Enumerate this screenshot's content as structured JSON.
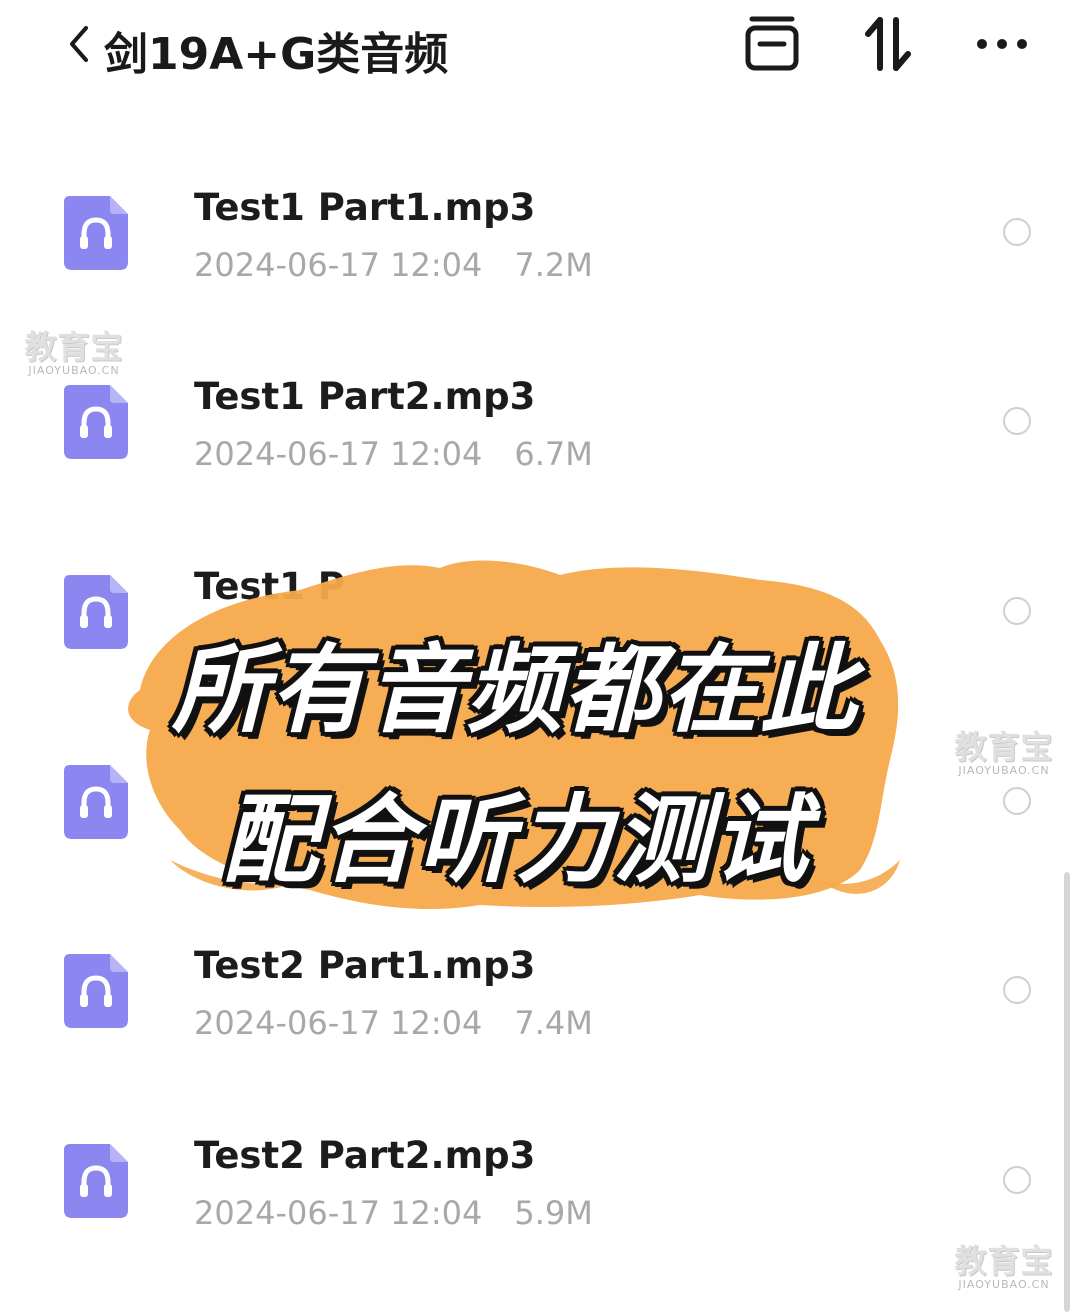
{
  "header": {
    "title": "剑19A+G类音频",
    "icons": [
      "chevron-left-icon",
      "select-icon",
      "sort-icon",
      "more-icon"
    ]
  },
  "files": [
    {
      "name": "Test1 Part1.mp3",
      "date": "2024-06-17 12:04",
      "size": "7.2M"
    },
    {
      "name": "Test1 Part2.mp3",
      "date": "2024-06-17 12:04",
      "size": "6.7M"
    },
    {
      "name": "Test1 P",
      "date": "",
      "size": ""
    },
    {
      "name": "",
      "date": "",
      "size": ""
    },
    {
      "name": "Test2 Part1.mp3",
      "date": "2024-06-17 12:04",
      "size": "7.4M"
    },
    {
      "name": "Test2 Part2.mp3",
      "date": "2024-06-17 12:04",
      "size": "5.9M"
    }
  ],
  "overlay": {
    "line1": "所有音频都在此",
    "line2": "配合听力测试",
    "brush_color": "#F5A94A"
  },
  "watermark": {
    "cn": "教育宝",
    "en": "JIAOYUBAO.CN"
  },
  "colors": {
    "icon_purple": "#8B86F0",
    "title": "#1a1a1a",
    "meta": "#a8a8a8"
  }
}
